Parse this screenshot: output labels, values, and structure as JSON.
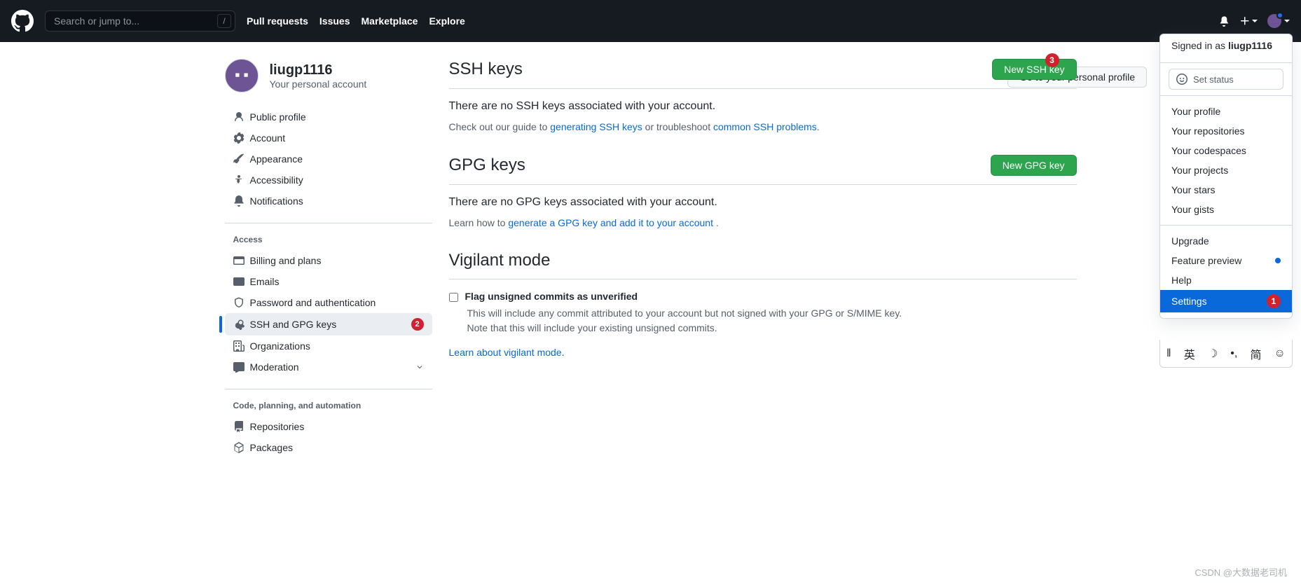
{
  "header": {
    "search_placeholder": "Search or jump to...",
    "nav": [
      "Pull requests",
      "Issues",
      "Marketplace",
      "Explore"
    ]
  },
  "dropdown": {
    "signed_in_prefix": "Signed in as ",
    "username": "liugp1116",
    "set_status": "Set status",
    "items_group1": [
      "Your profile",
      "Your repositories",
      "Your codespaces",
      "Your projects",
      "Your stars",
      "Your gists"
    ],
    "items_group2": [
      "Upgrade",
      "Feature preview",
      "Help",
      "Settings"
    ],
    "feature_preview_dot": true,
    "settings_badge": "1",
    "ime": [
      "英",
      "简"
    ]
  },
  "profile": {
    "username": "liugp1116",
    "subtitle": "Your personal account",
    "go_to_profile": "Go to your personal profile"
  },
  "sidebar": {
    "group1": [
      {
        "label": "Public profile",
        "icon": "person"
      },
      {
        "label": "Account",
        "icon": "gear"
      },
      {
        "label": "Appearance",
        "icon": "brush"
      },
      {
        "label": "Accessibility",
        "icon": "accessibility"
      },
      {
        "label": "Notifications",
        "icon": "bell"
      }
    ],
    "access_heading": "Access",
    "group2": [
      {
        "label": "Billing and plans",
        "icon": "card"
      },
      {
        "label": "Emails",
        "icon": "mail"
      },
      {
        "label": "Password and authentication",
        "icon": "shield"
      },
      {
        "label": "SSH and GPG keys",
        "icon": "key",
        "badge": "2",
        "active": true
      },
      {
        "label": "Organizations",
        "icon": "org"
      },
      {
        "label": "Moderation",
        "icon": "comment",
        "chevron": true
      }
    ],
    "code_heading": "Code, planning, and automation",
    "group3": [
      {
        "label": "Repositories",
        "icon": "repo"
      },
      {
        "label": "Packages",
        "icon": "package"
      }
    ]
  },
  "ssh": {
    "title": "SSH keys",
    "button": "New SSH key",
    "button_badge": "3",
    "empty": "There are no SSH keys associated with your account.",
    "help_prefix": "Check out our guide to ",
    "link1": "generating SSH keys",
    "help_mid": " or troubleshoot ",
    "link2": "common SSH problems",
    "help_suffix": "."
  },
  "gpg": {
    "title": "GPG keys",
    "button": "New GPG key",
    "empty": "There are no GPG keys associated with your account.",
    "help_prefix": "Learn how to ",
    "link": "generate a GPG key and add it to your account",
    "help_suffix": " ."
  },
  "vigilant": {
    "title": "Vigilant mode",
    "checkbox_label": "Flag unsigned commits as unverified",
    "desc1": "This will include any commit attributed to your account but not signed with your GPG or S/MIME key.",
    "desc2": "Note that this will include your existing unsigned commits.",
    "link": "Learn about vigilant mode",
    "link_suffix": "."
  },
  "watermark": "CSDN @大数据老司机"
}
